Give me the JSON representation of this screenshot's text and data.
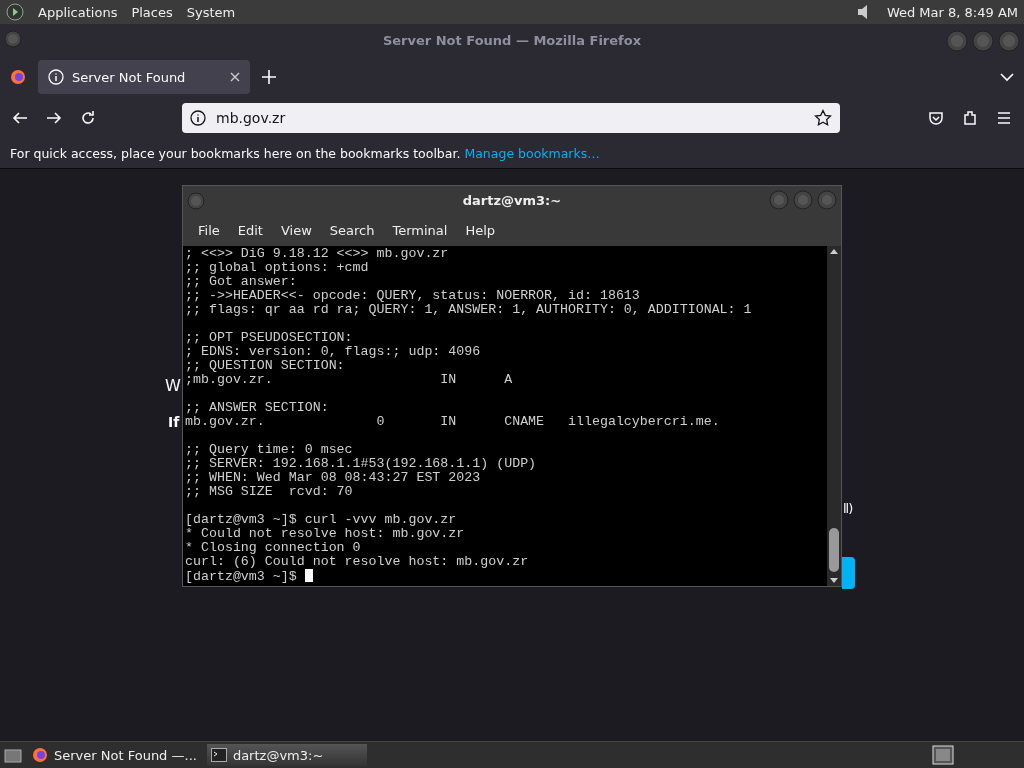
{
  "top_panel": {
    "menus": [
      "Applications",
      "Places",
      "System"
    ],
    "clock": "Wed Mar  8,  8:49 AM"
  },
  "window": {
    "title": "Server Not Found — Mozilla Firefox"
  },
  "tabs": [
    {
      "label": "Server Not Found",
      "selected": true
    }
  ],
  "address_bar": {
    "value": "mb.gov.zr"
  },
  "bookmarks_bar": {
    "message": "For quick access, place your bookmarks here on the bookmarks toolbar.",
    "link": "Manage bookmarks…"
  },
  "page_fragments": [
    "W",
    "If",
    "ll)"
  ],
  "terminal": {
    "title": "dartz@vm3:~",
    "menus": [
      "File",
      "Edit",
      "View",
      "Search",
      "Terminal",
      "Help"
    ],
    "blocks": [
      [
        "; <<>> DiG 9.18.12 <<>> mb.gov.zr",
        ";; global options: +cmd",
        ";; Got answer:",
        ";; ->>HEADER<<- opcode: QUERY, status: NOERROR, id: 18613",
        ";; flags: qr aa rd ra; QUERY: 1, ANSWER: 1, AUTHORITY: 0, ADDITIONAL: 1"
      ],
      [
        ";; OPT PSEUDOSECTION:",
        "; EDNS: version: 0, flags:; udp: 4096",
        ";; QUESTION SECTION:",
        ";mb.gov.zr.                     IN      A"
      ],
      [
        ";; ANSWER SECTION:",
        "mb.gov.zr.              0       IN      CNAME   illegalcybercri.me."
      ],
      [
        ";; Query time: 0 msec",
        ";; SERVER: 192.168.1.1#53(192.168.1.1) (UDP)",
        ";; WHEN: Wed Mar 08 08:43:27 EST 2023",
        ";; MSG SIZE  rcvd: 70"
      ],
      [
        "[dartz@vm3 ~]$ curl -vvv mb.gov.zr",
        "* Could not resolve host: mb.gov.zr",
        "* Closing connection 0",
        "curl: (6) Could not resolve host: mb.gov.zr",
        "[dartz@vm3 ~]$ "
      ]
    ]
  },
  "taskbar": {
    "items": [
      {
        "label": "Server Not Found —...",
        "kind": "browser",
        "selected": false
      },
      {
        "label": "dartz@vm3:~",
        "kind": "terminal",
        "selected": true
      }
    ]
  }
}
